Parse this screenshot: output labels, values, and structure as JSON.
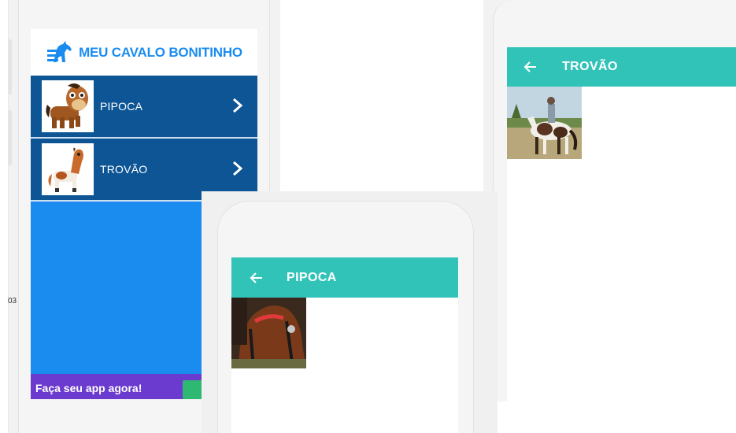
{
  "app": {
    "title": "MEU CAVALO BONITINHO",
    "logo_icon": "horse-logo-icon",
    "brand_color": "#1a8cf0"
  },
  "horse_list": [
    {
      "name": "PIPOCA",
      "thumb_icon": "brown-horse-cartoon",
      "chevron_icon": "chevron-right-icon"
    },
    {
      "name": "TROVÃO",
      "thumb_icon": "pinto-horse-cartoon",
      "chevron_icon": "chevron-right-icon"
    }
  ],
  "promo": {
    "text": "Faça seu app agora!",
    "button_color": "#2eb872",
    "bar_color": "#6b3bcf"
  },
  "edge_text": "03",
  "detail_trovao": {
    "title": "TROVÃO",
    "back_icon": "arrow-left-icon",
    "photo": "rider-on-pinto-horse-photo"
  },
  "detail_pipoca": {
    "title": "PIPOCA",
    "back_icon": "arrow-left-icon",
    "photo": "bay-horse-bridle-photo"
  },
  "colors": {
    "list_item": "#0d5594",
    "list_bg": "#1a8cf0",
    "appbar": "#32c3b8"
  }
}
